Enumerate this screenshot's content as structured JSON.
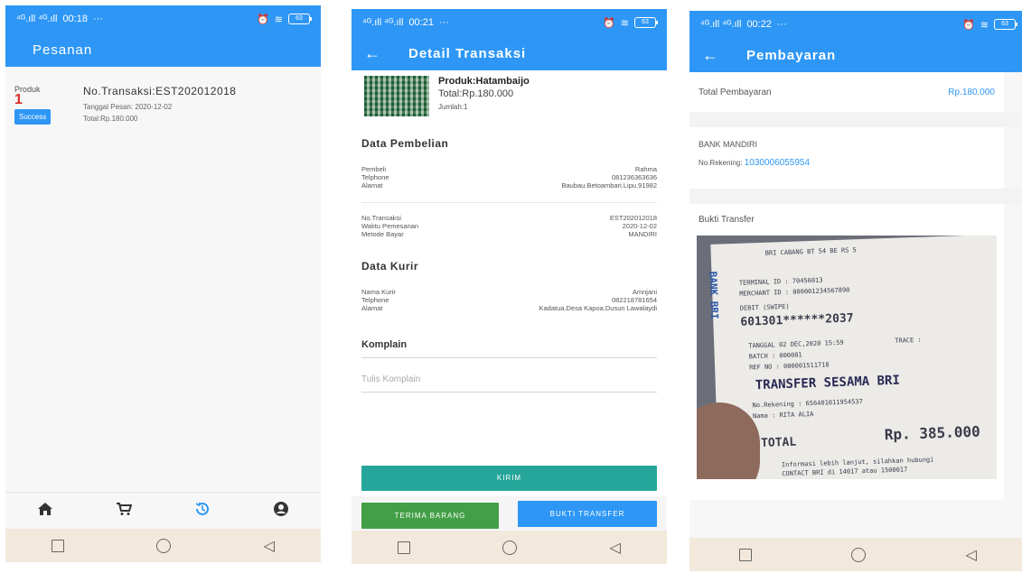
{
  "status": {
    "p1": {
      "network": "⁴ᴳ.ıll ⁴ᴳ.ıll",
      "time": "00:18",
      "more": "···",
      "battery": "63"
    },
    "p2": {
      "network": "⁴ᴳ.ıll ⁴ᴳ.ıll",
      "time": "00:21",
      "more": "···",
      "battery": "63"
    },
    "p3": {
      "network": "⁴ᴳ.ıll ⁴ᴳ.ıll",
      "time": "00:22",
      "more": "···",
      "battery": "63"
    }
  },
  "pesanan": {
    "title": "Pesanan",
    "order": {
      "produk_label": "Produk",
      "count": "1",
      "status": "Success",
      "no_transaksi": "No.Transaksi:EST202012018",
      "tanggal": "Tanggal Pesan: 2020-12-02",
      "total": "Total:Rp.180.000"
    },
    "nav": [
      "home-icon",
      "cart-icon",
      "history-icon",
      "account-icon"
    ]
  },
  "detail": {
    "title": "Detail Transaksi",
    "product": {
      "name": "Produk:Hatambaijo",
      "total": "Total:Rp.180.000",
      "qty": "Jumlah:1"
    },
    "pembelian_title": "Data Pembelian",
    "pembeli": {
      "label": "Pembeli",
      "value": "Rahma"
    },
    "telphone": {
      "label": "Telphone",
      "value": "081236363636"
    },
    "alamat": {
      "label": "Alamat",
      "value": "Baubau.Betoambari.Lipu.91982"
    },
    "no_transaksi": {
      "label": "No.Transaksi",
      "value": "EST202012018"
    },
    "waktu": {
      "label": "Waktu Pemesanan",
      "value": "2020-12-02"
    },
    "metode": {
      "label": "Metode Bayar",
      "value": "MANDIRI"
    },
    "kurir_title": "Data Kurir",
    "nama_kurir": {
      "label": "Nama Kurir",
      "value": "Amnjani"
    },
    "telphone_kurir": {
      "label": "Telphone",
      "value": "082218781654"
    },
    "alamat_kurir": {
      "label": "Alamat",
      "value": "Kadatua.Desa Kapoa.Dusun Lawalaydi"
    },
    "komplain_title": "Komplain",
    "komplain_placeholder": "Tulis Komplain",
    "kirim": "KIRIM",
    "terima": "TERIMA BARANG",
    "bukti": "BUKTI TRANSFER",
    "colors": {
      "kirim": "#26a69a",
      "terima": "#43a047",
      "bukti": "#2e97f5"
    }
  },
  "pembayaran": {
    "title": "Pembayaran",
    "total_label": "Total Pembayaran",
    "total_value": "Rp.180.000",
    "bank": "BANK MANDIRI",
    "rekening_label": "No.Rekening:",
    "rekening_value": "1030006055954",
    "bukti_title": "Bukti Transfer"
  },
  "receipt": {
    "line1": "BRI CABANG BT 54 BE RS 5",
    "line2": "TERMINAL ID : 70456013",
    "line3": "MERCHANT ID : 000001234567890",
    "line4": "DEBIT (SWIPE)",
    "line5": "601301******2037",
    "line6": "TANGGAL 02 DEC,2020 15:59",
    "line7": "TRACE :",
    "line8": "BATCH : 000001",
    "line9": "REF NO : 000001511718",
    "line10": "TRANSFER SESAMA BRI",
    "line11": "No.Rekening : 656401011954537",
    "line12": "Nama : RITA ALIA",
    "line13": "TOTAL",
    "line14": "Rp. 385.000",
    "line15": "Informasi lebih lanjut, silahkan hubungi",
    "line16": "CONTACT BRI di 14017 atau 1500017",
    "brand": "BANK BRI"
  }
}
